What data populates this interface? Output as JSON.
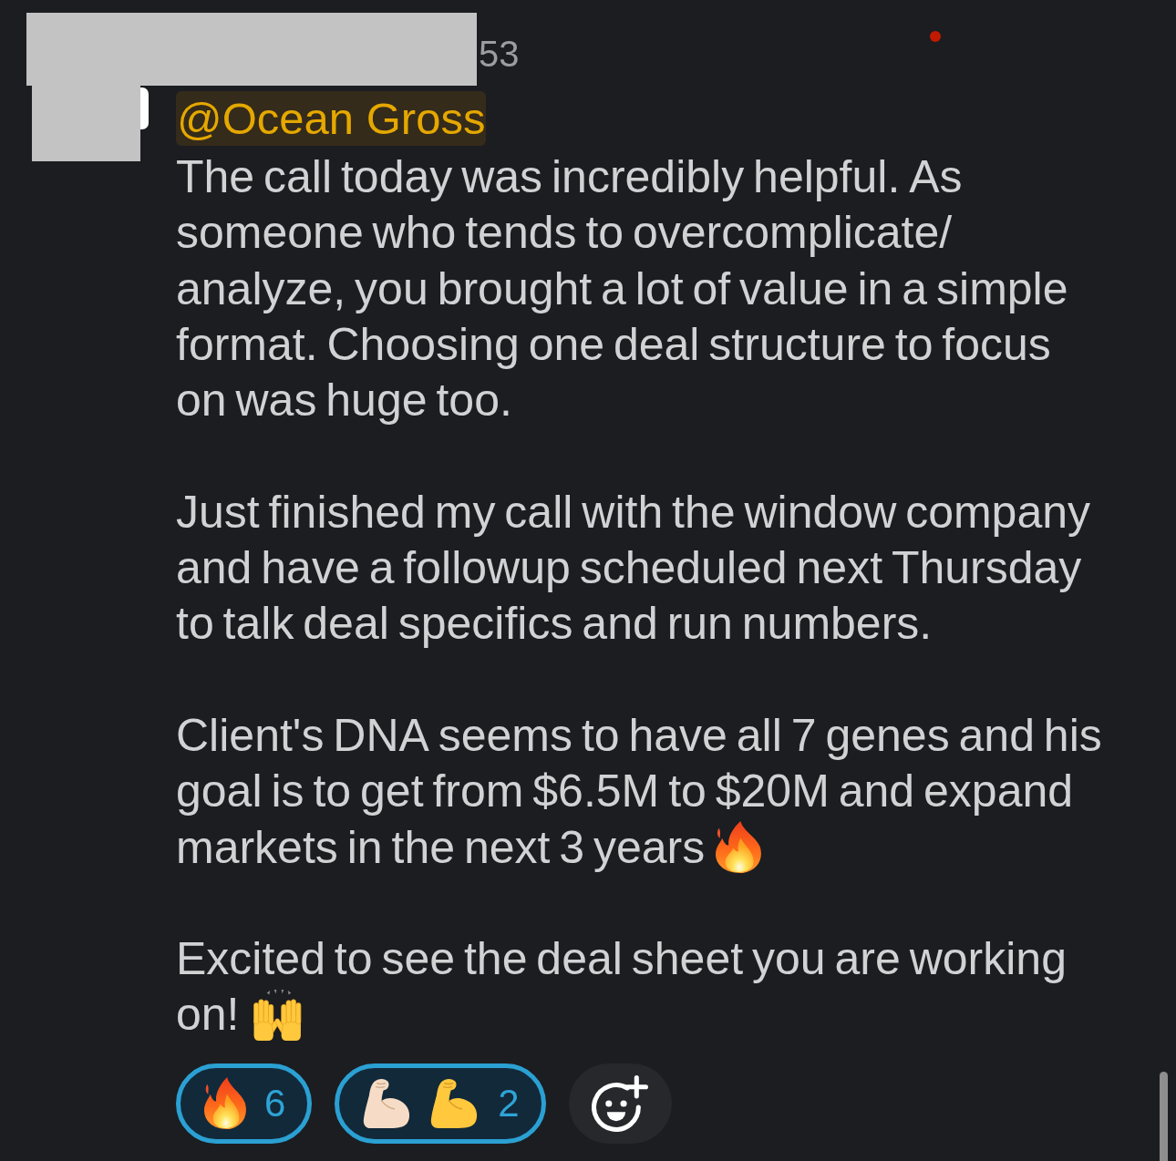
{
  "header": {
    "timestamp": "53"
  },
  "message": {
    "mention": "@Ocean Gross",
    "paragraphs": [
      {
        "text": "The call today was incredibly helpful. As someone who tends to overcomplicate/ analyze, you brought a lot of value in a simple format. Choosing one deal structure to focus on was huge too."
      },
      {
        "text": "Just finished my call with the window company and have a followup scheduled next Thursday to talk deal specifics and run numbers."
      },
      {
        "text": "Client's DNA seems to have all 7 genes and his goal is to get from $6.5M to $20M and expand markets in the next 3 years",
        "emoji": {
          "kind": "fire"
        }
      },
      {
        "text": "Excited to see the deal sheet you are working on!",
        "emoji": {
          "kind": "raising-hands"
        }
      }
    ]
  },
  "reactions": [
    {
      "emojis": [
        {
          "kind": "fire"
        }
      ],
      "count": "6",
      "selected": true
    },
    {
      "emojis": [
        {
          "kind": "flexed-biceps",
          "color": "#f6dcc6"
        },
        {
          "kind": "flexed-biceps",
          "color": "#ffc83d"
        }
      ],
      "count": "2",
      "selected": true
    }
  ]
}
